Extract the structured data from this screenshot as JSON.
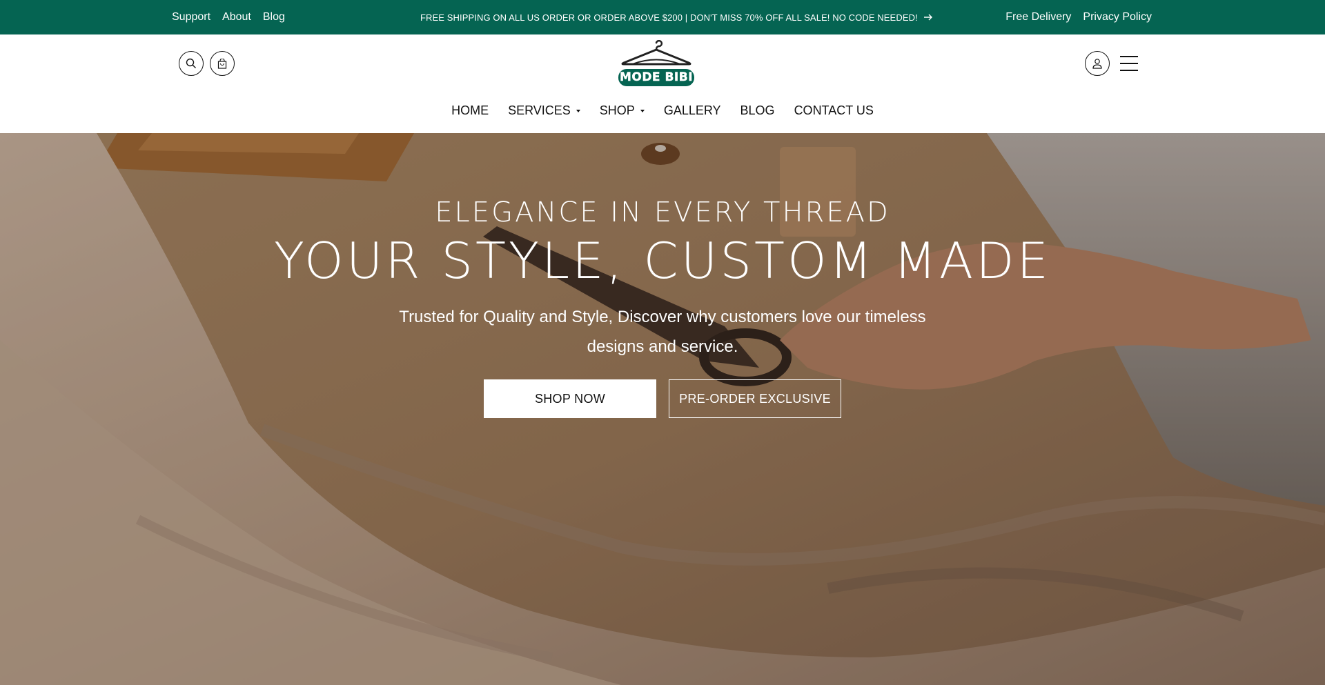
{
  "topbar": {
    "left_links": [
      "Support",
      "About",
      "Blog"
    ],
    "announcement": "FREE SHIPPING ON ALL US ORDER OR ORDER ABOVE $200 | DON'T MISS 70% OFF ALL SALE! NO CODE NEEDED!",
    "arrow_icon": "arrow-right-icon",
    "right_links": [
      "Free Delivery",
      "Privacy Policy"
    ]
  },
  "header": {
    "logo_text": "MODE BIBI",
    "search_icon": "search-icon",
    "cart_icon": "cart-icon",
    "account_icon": "user-icon",
    "menu_icon": "hamburger-icon"
  },
  "nav": {
    "items": [
      {
        "label": "HOME",
        "dropdown": false
      },
      {
        "label": "SERVICES",
        "dropdown": true
      },
      {
        "label": "SHOP",
        "dropdown": true
      },
      {
        "label": "GALLERY",
        "dropdown": false
      },
      {
        "label": "BLOG",
        "dropdown": false
      },
      {
        "label": "CONTACT US",
        "dropdown": false
      }
    ]
  },
  "hero": {
    "eyebrow": "ELEGANCE IN EVERY THREAD",
    "title": "YOUR STYLE, CUSTOM MADE",
    "subtitle": "Trusted for Quality and Style, Discover why customers love our timeless designs and service.",
    "primary_button": "SHOP NOW",
    "secondary_button": "PRE-ORDER EXCLUSIVE"
  },
  "colors": {
    "brand": "#056452",
    "text": "#111111",
    "white": "#ffffff"
  }
}
